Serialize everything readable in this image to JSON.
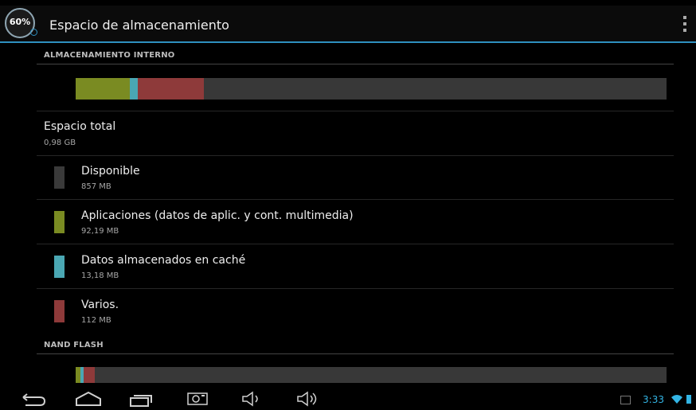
{
  "actionbar": {
    "icon_text": "60%",
    "title": "Espacio de almacenamiento"
  },
  "internal": {
    "section_title": "ALMACENAMIENTO INTERNO",
    "bar_segments": [
      {
        "name": "Aplicaciones",
        "fraction": 0.092,
        "color": "#7a8b22"
      },
      {
        "name": "Datos almacenados en caché",
        "fraction": 0.013,
        "color": "#4aa7b3"
      },
      {
        "name": "Varios.",
        "fraction": 0.112,
        "color": "#8e3a3a"
      },
      {
        "name": "Disponible",
        "fraction": 0.783,
        "color": "#383838"
      }
    ],
    "total_label": "Espacio total",
    "total_value": "0,98 GB",
    "items": [
      {
        "label": "Disponible",
        "value": "857 MB",
        "color": "#3a3a3a"
      },
      {
        "label": "Aplicaciones (datos de aplic. y cont. multimedia)",
        "value": "92,19 MB",
        "color": "#7a8b22"
      },
      {
        "label": "Datos almacenados en caché",
        "value": "13,18 MB",
        "color": "#4aa7b3"
      },
      {
        "label": "Varios.",
        "value": "112 MB",
        "color": "#8e3a3a"
      }
    ]
  },
  "nand": {
    "section_title": "NAND FLASH",
    "bar_segments": [
      {
        "name": "Aplicaciones",
        "fraction": 0.008,
        "color": "#7a8b22"
      },
      {
        "name": "Datos almacenados en caché",
        "fraction": 0.006,
        "color": "#4aa7b3"
      },
      {
        "name": "Varios.",
        "fraction": 0.018,
        "color": "#8e3a3a"
      },
      {
        "name": "Disponible",
        "fraction": 0.968,
        "color": "#383838"
      }
    ]
  },
  "navbar": {
    "icons": [
      "back-icon",
      "home-icon",
      "recent-apps-icon",
      "screenshot-icon",
      "volume-down-icon",
      "volume-up-icon"
    ]
  },
  "status": {
    "time": "3:33",
    "icons": [
      "image-notification-icon",
      "wifi-icon",
      "battery-icon"
    ]
  }
}
